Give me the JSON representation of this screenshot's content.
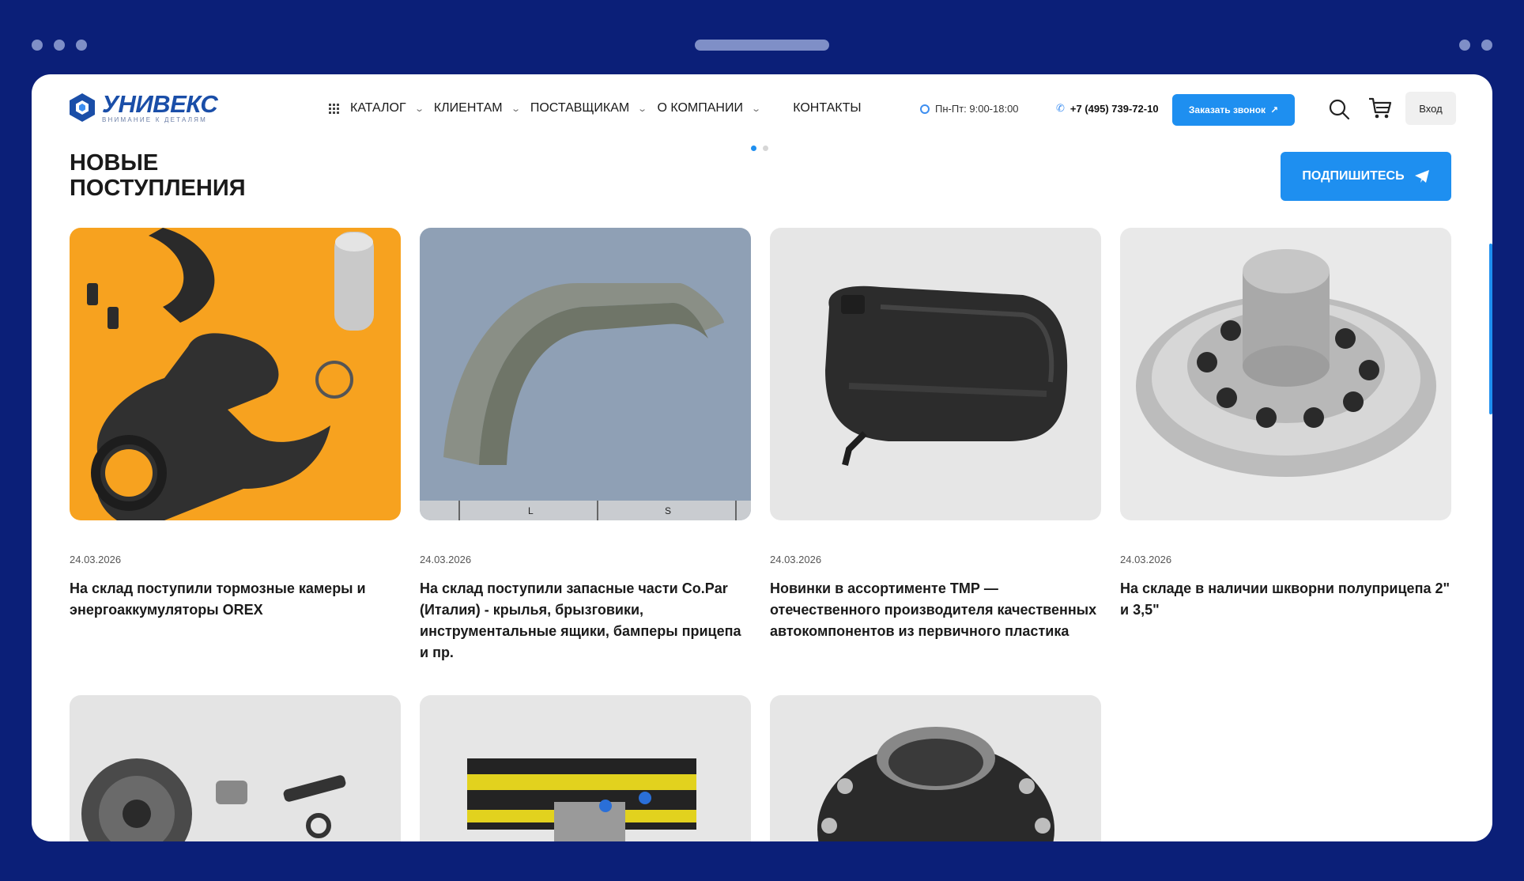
{
  "header": {
    "logo_name": "УНИВЕКС",
    "logo_tagline": "ВНИМАНИЕ К ДЕТАЛЯМ",
    "nav": [
      {
        "label": "КАТАЛОГ"
      },
      {
        "label": "КЛИЕНТАМ"
      },
      {
        "label": "ПОСТАВЩИКАМ"
      },
      {
        "label": "О КОМПАНИИ"
      },
      {
        "label": "КОНТАКТЫ"
      }
    ],
    "hours": "Пн-Пт: 9:00-18:00",
    "phone": "+7 (495) 739-72-10",
    "callback_label": "Заказать звонок",
    "login_label": "Вход"
  },
  "section": {
    "title": "НОВЫЕ ПОСТУПЛЕНИЯ",
    "subscribe_label": "ПОДПИШИТЕСЬ"
  },
  "cards": [
    {
      "date": "24.03.2026",
      "title": "На склад поступили тормозные камеры и энергоаккумуляторы OREX"
    },
    {
      "date": "24.03.2026",
      "title": "На склад поступили запасные части Co.Par (Италия) - крылья, брызговики, инструментальные ящики, бамперы прицепа и пр.",
      "image_labels": [
        "L",
        "S"
      ]
    },
    {
      "date": "24.03.2026",
      "title": "Новинки в ассортименте ТМР — отечественного производителя качественных автокомпонентов из первичного пластика"
    },
    {
      "date": "24.03.2026",
      "title": "На складе в наличии шкворни полуприцепа 2\" и 3,5\""
    },
    {
      "date": "",
      "title": ""
    },
    {
      "date": "",
      "title": ""
    },
    {
      "date": "",
      "title": ""
    }
  ],
  "colors": {
    "frame": "#0b1f78",
    "accent": "#1e8ff0",
    "brand": "#1a4ea8"
  }
}
